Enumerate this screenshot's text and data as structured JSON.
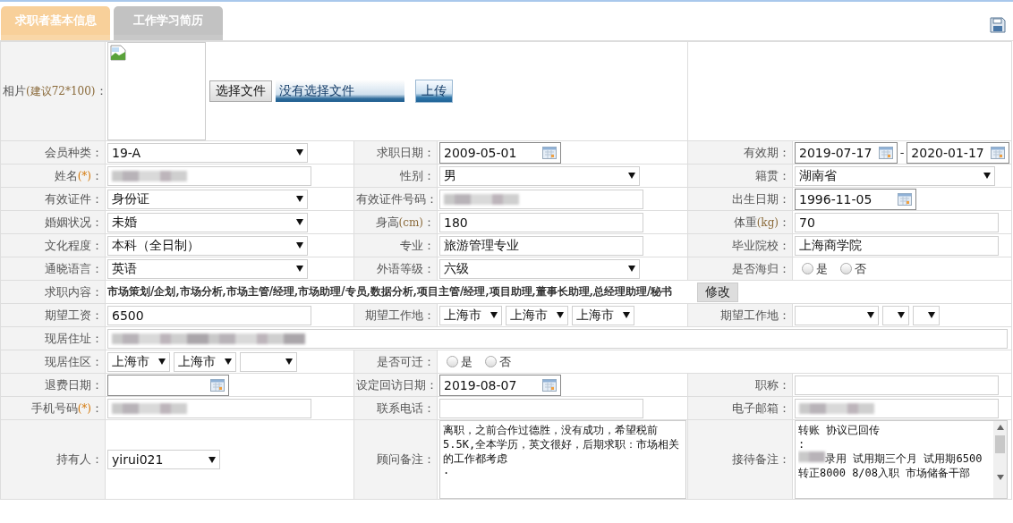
{
  "tabs": [
    {
      "label": "求职者基本信息",
      "selected": true
    },
    {
      "label": "工作学习简历",
      "selected": false
    }
  ],
  "rows": [
    {
      "cells": [
        {
          "label": {
            "text": "相片",
            "note": "(建议72*100)",
            "tail": "："
          },
          "field": {
            "kind": "photo",
            "choose": "选择文件",
            "status": "没有选择文件",
            "upload": "上传"
          }
        },
        {
          "field": {
            "kind": "empty"
          }
        }
      ]
    },
    {
      "cells": [
        {
          "label": {
            "text": "会员种类："
          },
          "field": {
            "kind": "select",
            "value": "19-A"
          }
        },
        {
          "label": {
            "text": "求职日期："
          },
          "field": {
            "kind": "date",
            "value": "2009-05-01"
          }
        },
        {
          "label": {
            "text": "有效期："
          },
          "field": {
            "kind": "date_range",
            "from": "2019-07-17",
            "sep": "-",
            "to": "2020-01-17"
          }
        }
      ]
    },
    {
      "cells": [
        {
          "label": {
            "text": "姓名",
            "note": "(*)",
            "tail": "："
          },
          "field": {
            "kind": "input",
            "redacted": true
          }
        },
        {
          "label": {
            "text": "性别："
          },
          "field": {
            "kind": "select",
            "value": "男"
          }
        },
        {
          "label": {
            "text": "籍贯："
          },
          "field": {
            "kind": "select",
            "value": "湖南省"
          }
        }
      ]
    },
    {
      "cells": [
        {
          "label": {
            "text": "有效证件："
          },
          "field": {
            "kind": "select",
            "value": "身份证"
          }
        },
        {
          "label": {
            "text": "有效证件号码："
          },
          "field": {
            "kind": "input",
            "redacted": true
          }
        },
        {
          "label": {
            "text": "出生日期："
          },
          "field": {
            "kind": "date",
            "value": "1996-11-05"
          }
        }
      ]
    },
    {
      "cells": [
        {
          "label": {
            "text": "婚姻状况："
          },
          "field": {
            "kind": "select",
            "value": "未婚"
          }
        },
        {
          "label": {
            "text": "身高",
            "note": "(cm)",
            "tail": "："
          },
          "field": {
            "kind": "input",
            "value": "180",
            "redacted": false
          }
        },
        {
          "label": {
            "text": "体重",
            "note": "(kg)",
            "tail": "："
          },
          "field": {
            "kind": "input",
            "value": "70",
            "redacted": false
          }
        }
      ]
    },
    {
      "cells": [
        {
          "label": {
            "text": "文化程度："
          },
          "field": {
            "kind": "select",
            "value": "本科（全日制）"
          }
        },
        {
          "label": {
            "text": "专业："
          },
          "field": {
            "kind": "input",
            "value": "旅游管理专业",
            "redacted": false
          }
        },
        {
          "label": {
            "text": "毕业院校："
          },
          "field": {
            "kind": "input",
            "value": "上海商学院",
            "redacted": false
          }
        }
      ]
    },
    {
      "cells": [
        {
          "label": {
            "text": "通晓语言："
          },
          "field": {
            "kind": "select",
            "value": "英语"
          }
        },
        {
          "label": {
            "text": "外语等级："
          },
          "field": {
            "kind": "select",
            "value": "六级"
          }
        },
        {
          "label": {
            "text": "是否海归："
          },
          "field": {
            "kind": "radio",
            "options": [
              {
                "label": "是",
                "selected": false
              },
              {
                "label": "否",
                "selected": false
              }
            ]
          }
        }
      ]
    },
    {
      "cells": [
        {
          "label": {
            "text": "求职内容："
          },
          "field": {
            "kind": "summary",
            "text": "市场策划/企划,市场分析,市场主管/经理,市场助理/专员,数据分析,项目主管/经理,项目助理,董事长助理,总经理助理/秘书",
            "button": "修改"
          }
        }
      ]
    },
    {
      "cells": [
        {
          "label": {
            "text": "期望工资："
          },
          "field": {
            "kind": "input",
            "value": "6500",
            "redacted": false
          }
        },
        {
          "label": {
            "text": "期望工作地："
          },
          "field": {
            "kind": "select_group",
            "options": [
              {
                "kind": "dropdown",
                "value": "上海市"
              },
              {
                "kind": "dropdown",
                "value": "上海市"
              },
              {
                "kind": "dropdown",
                "value": "上海市"
              }
            ]
          }
        },
        {
          "label": {
            "text": "期望工作地："
          },
          "field": {
            "kind": "select_group",
            "options": [
              {
                "kind": "dropdown"
              },
              {
                "kind": "dropdown"
              },
              {
                "kind": "dropdown"
              }
            ]
          }
        }
      ]
    },
    {
      "cells": [
        {
          "label": {
            "text": "现居住址："
          },
          "field": {
            "kind": "wide_input",
            "redacted": true
          }
        }
      ]
    },
    {
      "cells": [
        {
          "label": {
            "text": "现居住区："
          },
          "field": {
            "kind": "select_group",
            "options": [
              {
                "kind": "dropdown",
                "value": "上海市"
              },
              {
                "kind": "dropdown",
                "value": "上海市"
              },
              {
                "kind": "dropdown"
              }
            ]
          }
        },
        {
          "label": {
            "text": "是否可迁："
          },
          "field": {
            "kind": "radio",
            "options": [
              {
                "label": "是",
                "selected": false
              },
              {
                "label": "否",
                "selected": false
              }
            ]
          }
        }
      ]
    },
    {
      "cells": [
        {
          "label": {
            "text": "退费日期："
          },
          "field": {
            "kind": "date"
          }
        },
        {
          "label": {
            "text": "设定回访日期："
          },
          "field": {
            "kind": "date",
            "value": "2019-08-07"
          }
        },
        {
          "label": {
            "text": "职称："
          },
          "field": {
            "kind": "input",
            "redacted": false
          }
        }
      ]
    },
    {
      "cells": [
        {
          "label": {
            "text": "手机号码",
            "note": "(*)",
            "tail": "："
          },
          "field": {
            "kind": "input",
            "redacted": true
          }
        },
        {
          "label": {
            "text": "联系电话："
          },
          "field": {
            "kind": "input",
            "redacted": false
          }
        },
        {
          "label": {
            "text": "电子邮箱："
          },
          "field": {
            "kind": "input",
            "redacted": true
          }
        }
      ]
    },
    {
      "cells": [
        {
          "label": {
            "text": "持有人："
          },
          "field": {
            "kind": "short_select",
            "value": "yirui021"
          }
        },
        {
          "label": {
            "text": "顾问备注："
          },
          "field": {
            "kind": "textarea",
            "lines": [
              {
                "text": "离职，之前合作过德胜，没有成功，希望税前5.5K,全本学历，英文很好，后期求职：市场相关的工作都考虑"
              },
              {
                "text": "·"
              }
            ],
            "scrollbar": false
          }
        },
        {
          "label": {
            "text": "接待备注："
          },
          "field": {
            "kind": "textarea",
            "lines": [
              {
                "text": "转账  协议已回传"
              },
              {
                "text": ":"
              },
              {
                "text": "录用  试用期三个月  试用期6500 转正8000 8/08入职 市场储备干部",
                "redacted_prefix": true
              }
            ],
            "scrollbar": true
          }
        }
      ]
    }
  ]
}
